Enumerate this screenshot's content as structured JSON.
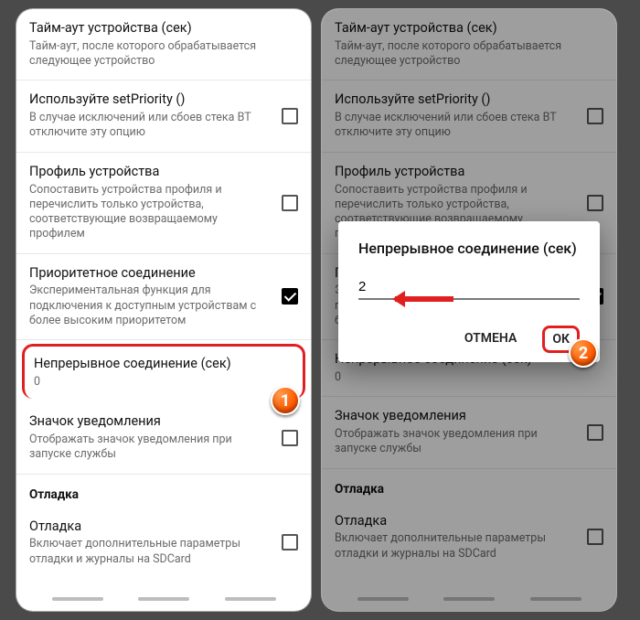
{
  "items": {
    "timeout": {
      "title": "Тайм-аут устройства (сек)",
      "sub": "Тайм-аут, после которого обрабатывается следующее устройство"
    },
    "setpriority": {
      "title": "Используйте setPriority ()",
      "sub": "В случае исключений или сбоев стека BT отключите эту опцию"
    },
    "profile": {
      "title": "Профиль устройства",
      "sub": "Сопоставить устройства профиля и перечислить только устройства, соответствующие возвращаемому профилем"
    },
    "priorityconn": {
      "title": "Приоритетное соединение",
      "sub": "Экспериментальная функция для подключения к доступным устройствам с более высоким приоритетом"
    },
    "continuous": {
      "title": "Непрерывное соединение (сек)",
      "value": "0"
    },
    "notificon": {
      "title": "Значок уведомления",
      "sub": "Отображать значок уведомления при запуске службы"
    },
    "section_debug": "Отладка",
    "debug": {
      "title": "Отладка",
      "sub": "Включает дополнительные параметры отладки и журналы на SDCard"
    }
  },
  "dialog": {
    "title": "Непрерывное соединение (сек)",
    "value": "2",
    "cancel": "ОТМЕНА",
    "ok": "ОК"
  },
  "markers": {
    "one": "1",
    "two": "2"
  }
}
